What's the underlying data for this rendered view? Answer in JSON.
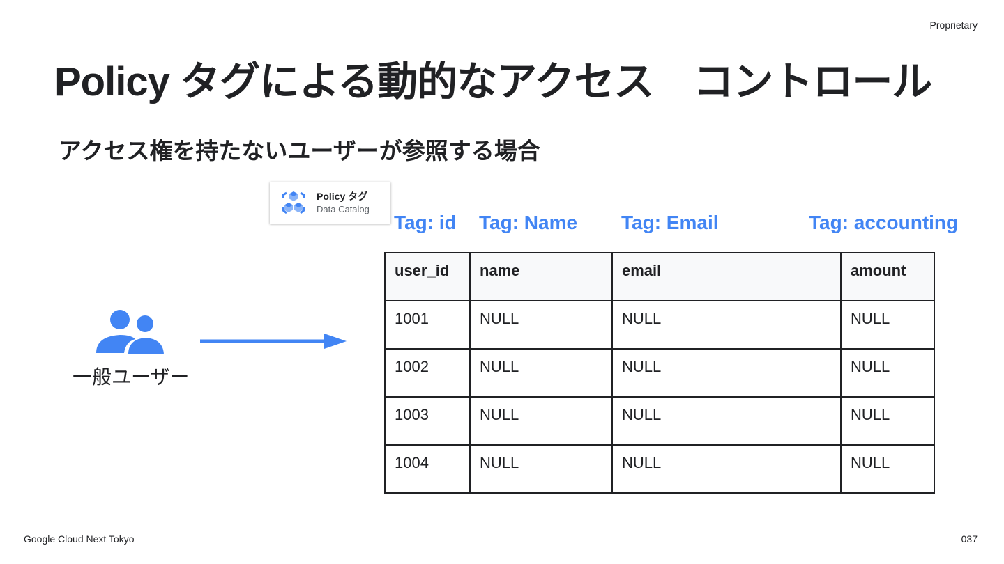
{
  "header": {
    "label": "Proprietary"
  },
  "title": "Policy タグによる動的なアクセス　コントロール",
  "subtitle": "アクセス権を持たないユーザーが参照する場合",
  "policy_card": {
    "name": "Policy タグ",
    "source": "Data Catalog",
    "icon": "data-catalog-icon"
  },
  "tags": [
    "Tag: id",
    "Tag: Name",
    "Tag: Email",
    "Tag: accounting"
  ],
  "user": {
    "label": "一般ユーザー",
    "icon": "people-icon"
  },
  "table": {
    "columns": [
      "user_id",
      "name",
      "email",
      "amount"
    ],
    "rows": [
      [
        "1001",
        "NULL",
        "NULL",
        "NULL"
      ],
      [
        "1002",
        "NULL",
        "NULL",
        "NULL"
      ],
      [
        "1003",
        "NULL",
        "NULL",
        "NULL"
      ],
      [
        "1004",
        "NULL",
        "NULL",
        "NULL"
      ]
    ]
  },
  "footer": {
    "left": "Google Cloud Next Tokyo",
    "page": "037"
  },
  "colors": {
    "accent": "#4285f4",
    "text": "#202124",
    "header_bg": "#f8f9fa"
  }
}
